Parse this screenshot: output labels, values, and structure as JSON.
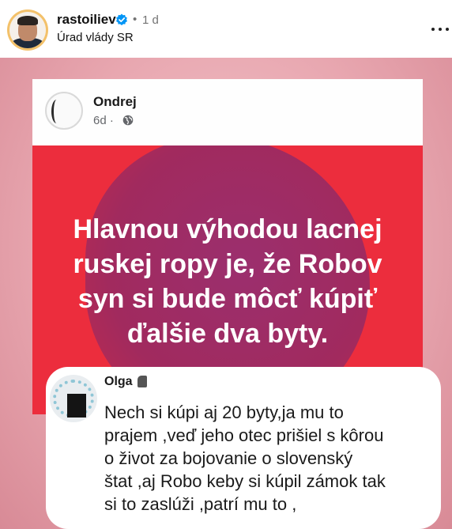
{
  "post": {
    "username": "rastoiliev",
    "separator": "•",
    "time": "1 d",
    "location": "Úrad vlády SR",
    "more_icon": "more-horizontal-icon",
    "verified_icon": "verified-badge-icon"
  },
  "image": {
    "fb_post": {
      "author": "Ondrej",
      "meta": "6d ·",
      "privacy_icon": "globe-icon"
    },
    "quote_lines": [
      "Hlavnou výhodou lacnej",
      "ruskej ropy je, že Robov",
      "syn si bude môcť kúpiť",
      "ďalšie dva byty."
    ],
    "comment": {
      "author": "Olga",
      "text_lines": [
        "Nech si kúpi aj 20 byty,ja mu to",
        "prajem ,veď jeho otec prišiel s kôrou",
        "o život za bojovanie o slovenský",
        "štat ,aj Robo keby si kúpil zámok tak",
        "si to zaslúži ,patrí mu to ,"
      ]
    }
  },
  "colors": {
    "red_panel": "#ec2d3d",
    "blob": "#9b2f6e",
    "pink_background": "#e8a7b0",
    "verified_blue": "#0095f6"
  }
}
